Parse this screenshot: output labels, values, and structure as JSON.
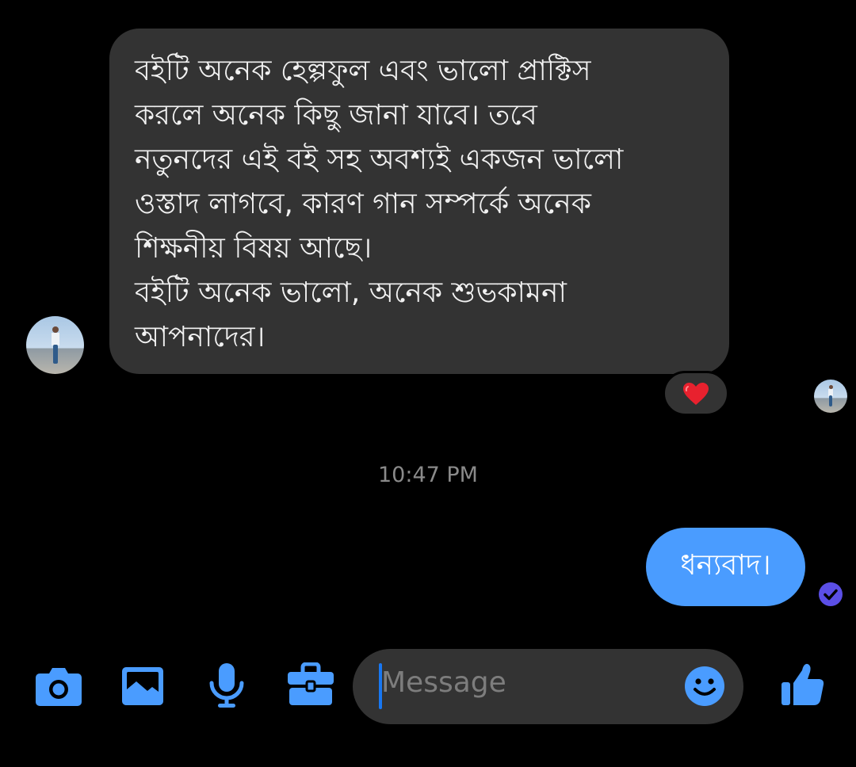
{
  "conversation": {
    "incoming_message": {
      "lines": [
        "বইটি অনেক হেল্পফুল এবং ভালো প্রাক্টিস",
        "করলে অনেক কিছু জানা যাবে। তবে",
        "নতুনদের এই বই সহ অবশ্যই একজন ভালো",
        "ওস্তাদ লাগবে, কারণ গান সম্পর্কে অনেক",
        "শিক্ষনীয় বিষয় আছে।",
        "বইটি অনেক ভালো, অনেক শুভকামনা",
        "আপনাদের।"
      ],
      "reaction": "❤️"
    },
    "timestamp": "10:47 PM",
    "outgoing_message": {
      "text": "ধন্যবাদ।"
    }
  },
  "composer": {
    "placeholder": "Message"
  },
  "colors": {
    "accent": "#4a9cff",
    "bubble_incoming": "#333333",
    "background": "#000000",
    "seen_check": "#5b4fe6"
  },
  "icons": [
    "camera-icon",
    "gallery-icon",
    "microphone-icon",
    "briefcase-icon",
    "emoji-icon",
    "thumbs-up-icon",
    "heart-icon",
    "check-icon"
  ]
}
